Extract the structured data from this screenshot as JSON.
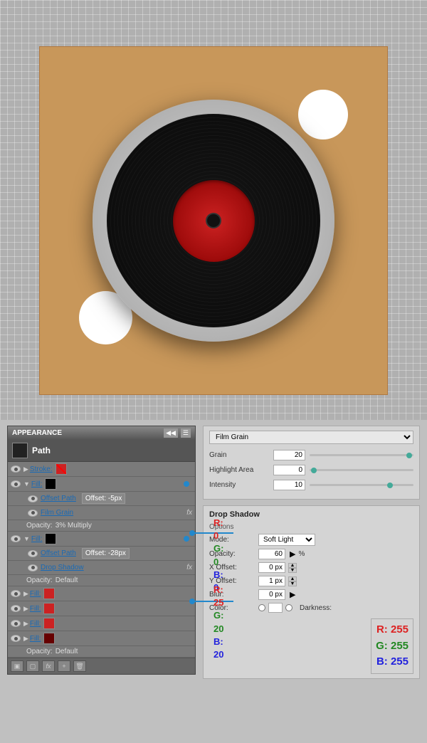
{
  "canvas": {
    "background_color": "#b8b8b8"
  },
  "vinyl_icon": {
    "card_color": "#c8975a",
    "record_color": "#111111",
    "label_color": "#cc2222",
    "circle1_color": "#ffffff",
    "circle2_color": "#ffffff"
  },
  "appearance_panel": {
    "title": "APPEARANCE",
    "path_label": "Path",
    "stroke_label": "Stroke:",
    "fill_label": "Fill:",
    "offset_path_label": "Offset Path",
    "film_grain_label": "Film Grain",
    "opacity_label_1": "Opacity:",
    "opacity_value_1": "3% Multiply",
    "offset_value_1": "Offset: -5px",
    "drop_shadow_label": "Drop Shadow",
    "opacity_label_2": "Opacity:",
    "opacity_value_2": "Default",
    "opacity_value_3": "Default",
    "offset_value_2": "Offset: -28px",
    "offset_path_label_2": "Offset Path",
    "fill_labels": [
      "Fill:",
      "Fill:",
      "Fill:",
      "Fill:"
    ],
    "toolbar_buttons": [
      "square",
      "rounded",
      "fx",
      "add",
      "trash"
    ]
  },
  "film_grain_panel": {
    "title": "Film Grain",
    "grain_label": "Grain",
    "grain_value": "20",
    "highlight_label": "Highlight Area",
    "highlight_value": "0",
    "intensity_label": "Intensity",
    "intensity_value": "10"
  },
  "drop_shadow_panel": {
    "title": "Drop Shadow",
    "options_label": "Options",
    "mode_label": "Mode:",
    "mode_value": "Soft Light",
    "opacity_label": "Opacity:",
    "opacity_value": "60",
    "opacity_unit": "%",
    "x_offset_label": "X Offset:",
    "x_offset_value": "0 px",
    "y_offset_label": "Y Offset:",
    "y_offset_value": "1 px",
    "blur_label": "Blur:",
    "blur_value": "0 px",
    "color_label": "Color:",
    "darkness_label": "Darkness:"
  },
  "rgb_values": {
    "fill1_r": "R: 0",
    "fill1_g": "G: 0",
    "fill1_b": "B: 0",
    "fill2_r": "R: 25",
    "fill2_g": "G: 20",
    "fill2_b": "B: 20",
    "ds_r": "R: 255",
    "ds_g": "G: 255",
    "ds_b": "B: 255"
  }
}
